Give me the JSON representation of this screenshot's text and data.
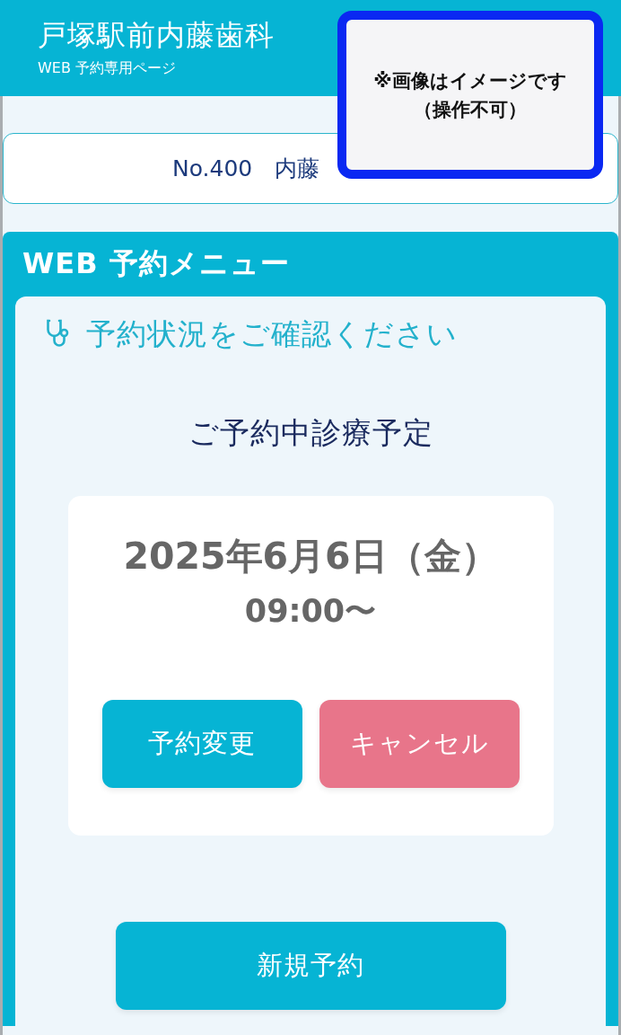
{
  "header": {
    "title": "戸塚駅前内藤歯科",
    "subtitle": "WEB 予約専用ページ"
  },
  "patient_bar": {
    "text": "No.400　内藤"
  },
  "notice": {
    "lines": [
      "※画像はイメージです",
      "（操作不可）"
    ]
  },
  "menu": {
    "title": "WEB 予約メニュー",
    "status_heading": "予約状況をご確認ください",
    "section_title": "ご予約中診療予定",
    "appointment": {
      "date": "2025年6月6日（金）",
      "time": "09:00〜",
      "buttons": [
        {
          "label": "予約変更",
          "kind": "primary"
        },
        {
          "label": "キャンセル",
          "kind": "danger"
        }
      ]
    },
    "new_booking_button": {
      "label": "新規予約"
    }
  }
}
